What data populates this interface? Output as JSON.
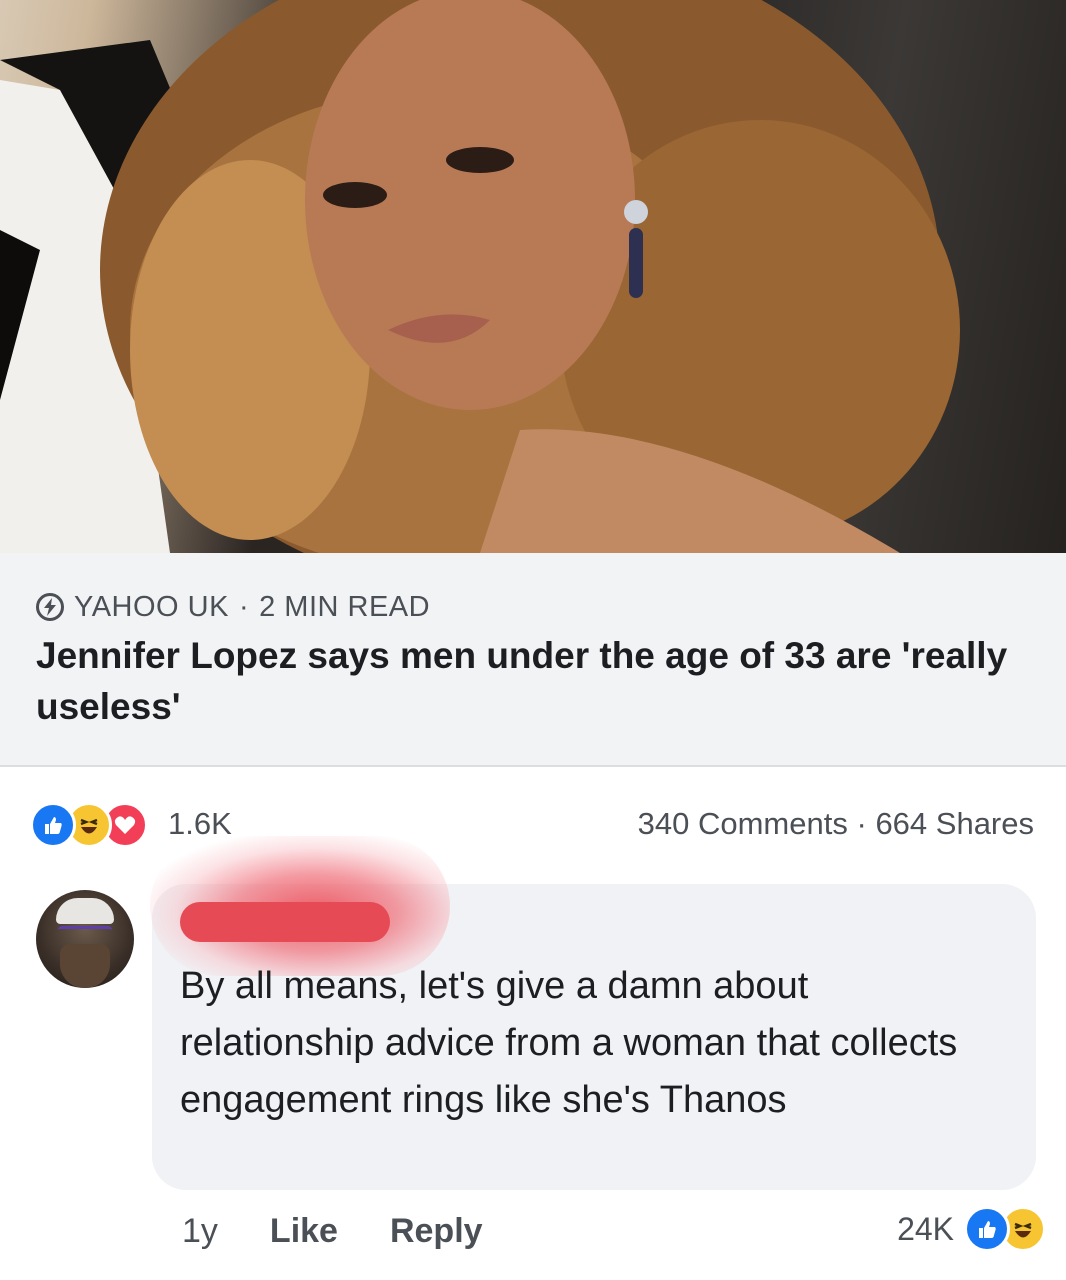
{
  "post": {
    "link": {
      "source": "YAHOO UK",
      "separator": "·",
      "read_time": "2 MIN READ",
      "headline": "Jennifer Lopez says men under the age of 33 are 'really useless'"
    },
    "reactions": {
      "icons": [
        "like-icon",
        "haha-icon",
        "love-icon"
      ],
      "count": "1.6K"
    },
    "comments_count": "340 Comments",
    "dot": "·",
    "shares_count": "664 Shares"
  },
  "comment": {
    "author": "",
    "text": "By all means,  let's give a damn about relationship advice from a woman that collects engagement rings like she's Thanos",
    "time": "1y",
    "like_label": "Like",
    "reply_label": "Reply",
    "reaction_count": "24K",
    "reaction_icons": [
      "like-icon",
      "haha-icon"
    ]
  },
  "colors": {
    "like": "#1877f2",
    "haha": "#f7c531",
    "love": "#f33e58",
    "card_bg": "#f2f3f5",
    "bubble_bg": "#f0f2f5",
    "redaction": "#e64a55"
  }
}
